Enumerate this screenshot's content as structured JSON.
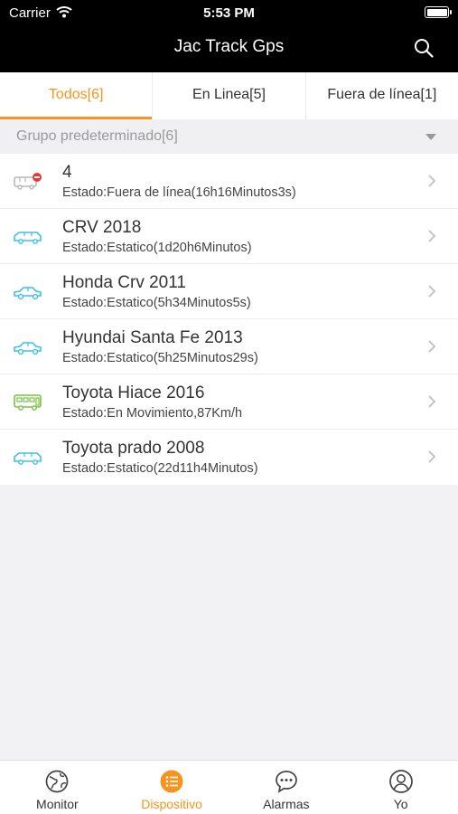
{
  "status_bar": {
    "carrier": "Carrier",
    "time": "5:53 PM"
  },
  "header": {
    "title": "Jac Track Gps",
    "search_icon": "search-icon"
  },
  "tabs": [
    {
      "label": "Todos[6]",
      "active": true
    },
    {
      "label": "En Linea[5]",
      "active": false
    },
    {
      "label": "Fuera de línea[1]",
      "active": false
    }
  ],
  "group": {
    "label": "Grupo predeterminado[6]"
  },
  "devices": [
    {
      "name": "4",
      "status": "Estado:Fuera de línea(16h16Minutos3s)",
      "icon": "van-offline-icon",
      "color": "#b8b8b8"
    },
    {
      "name": "CRV 2018",
      "status": "Estado:Estatico(1d20h6Minutos)",
      "icon": "suv-icon",
      "color": "#3ec1e6"
    },
    {
      "name": "Honda Crv 2011",
      "status": "Estado:Estatico(5h34Minutos5s)",
      "icon": "car-icon",
      "color": "#3ec1e6"
    },
    {
      "name": "Hyundai Santa Fe 2013",
      "status": "Estado:Estatico(5h25Minutos29s)",
      "icon": "car-icon",
      "color": "#3ec1e6"
    },
    {
      "name": "Toyota Hiace 2016",
      "status": "Estado:En Movimiento,87Km/h",
      "icon": "bus-icon",
      "color": "#7cc242"
    },
    {
      "name": "Toyota prado 2008",
      "status": "Estado:Estatico(22d11h4Minutos)",
      "icon": "suv-icon",
      "color": "#3ec1e6"
    }
  ],
  "bottom_tabs": [
    {
      "label": "Monitor",
      "icon": "globe-icon",
      "active": false
    },
    {
      "label": "Dispositivo",
      "icon": "list-icon",
      "active": true
    },
    {
      "label": "Alarmas",
      "icon": "chat-bubble-icon",
      "active": false
    },
    {
      "label": "Yo",
      "icon": "user-icon",
      "active": false
    }
  ],
  "colors": {
    "accent": "#f7941d",
    "online": "#3ec1e6",
    "moving": "#7cc242",
    "offline": "#b8b8b8"
  }
}
